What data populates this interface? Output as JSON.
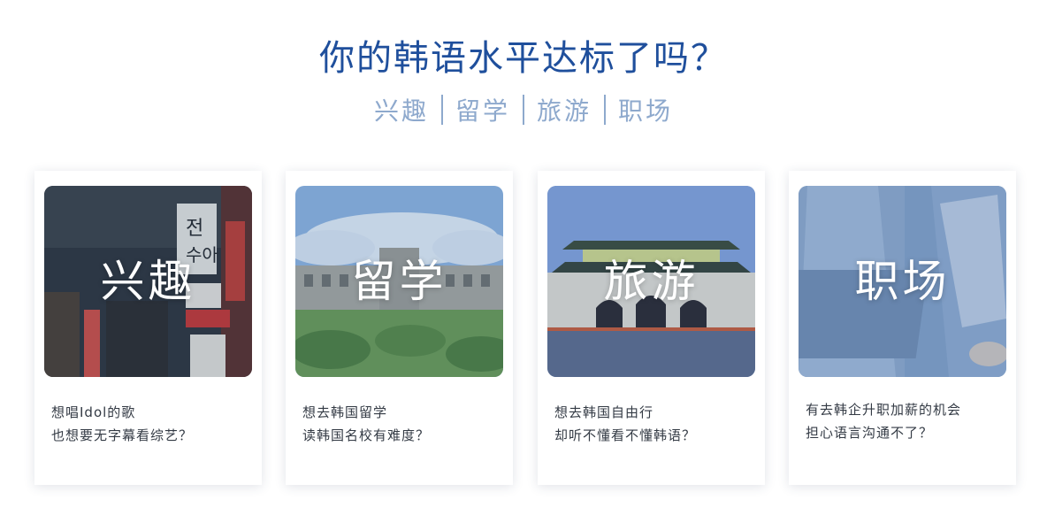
{
  "header": {
    "title": "你的韩语水平达标了吗？",
    "tags": [
      "兴趣",
      "留学",
      "旅游",
      "职场"
    ]
  },
  "cards": [
    {
      "image_label": "兴趣",
      "image_icon": "night-street-signs-photo",
      "line1": "想唱Idol的歌",
      "line2": "也想要无字幕看综艺？"
    },
    {
      "image_label": "留学",
      "image_icon": "university-campus-photo",
      "line1": "想去韩国留学",
      "line2": "读韩国名校有难度？"
    },
    {
      "image_label": "旅游",
      "image_icon": "palace-gate-photo",
      "line1": "想去韩国自由行",
      "line2": "却听不懂看不懂韩语？"
    },
    {
      "image_label": "职场",
      "image_icon": "office-workers-photo",
      "line1": "有去韩企升职加薪的机会",
      "line2": "担心语言沟通不了？"
    }
  ],
  "colors": {
    "title": "#1f4f9c",
    "subtitle": "#8ea9cd",
    "image_overlay": "#3a6ea8"
  }
}
